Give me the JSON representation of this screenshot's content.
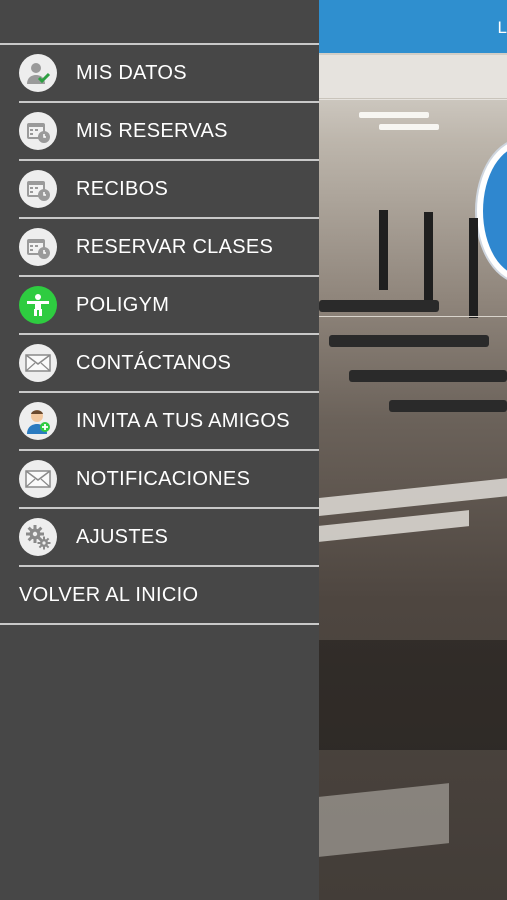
{
  "header": {
    "right_text": "L"
  },
  "menu": {
    "items": [
      {
        "label": "MIS DATOS",
        "icon": "user-check-icon"
      },
      {
        "label": "MIS RESERVAS",
        "icon": "calendar-clock-icon"
      },
      {
        "label": "RECIBOS",
        "icon": "calendar-clock-icon"
      },
      {
        "label": "RESERVAR CLASES",
        "icon": "calendar-clock-icon"
      },
      {
        "label": "POLIGYM",
        "icon": "gym-person-icon"
      },
      {
        "label": "CONTÁCTANOS",
        "icon": "envelope-icon"
      },
      {
        "label": "INVITA A TUS AMIGOS",
        "icon": "invite-person-icon"
      },
      {
        "label": "NOTIFICACIONES",
        "icon": "envelope-icon"
      },
      {
        "label": "AJUSTES",
        "icon": "gears-icon"
      }
    ],
    "home_link": "VOLVER AL INICIO"
  },
  "colors": {
    "menu_bg": "#474747",
    "divider": "#c9c9c9",
    "topbar": "#2f8fcf",
    "poligym_icon_bg": "#2ecc40"
  }
}
